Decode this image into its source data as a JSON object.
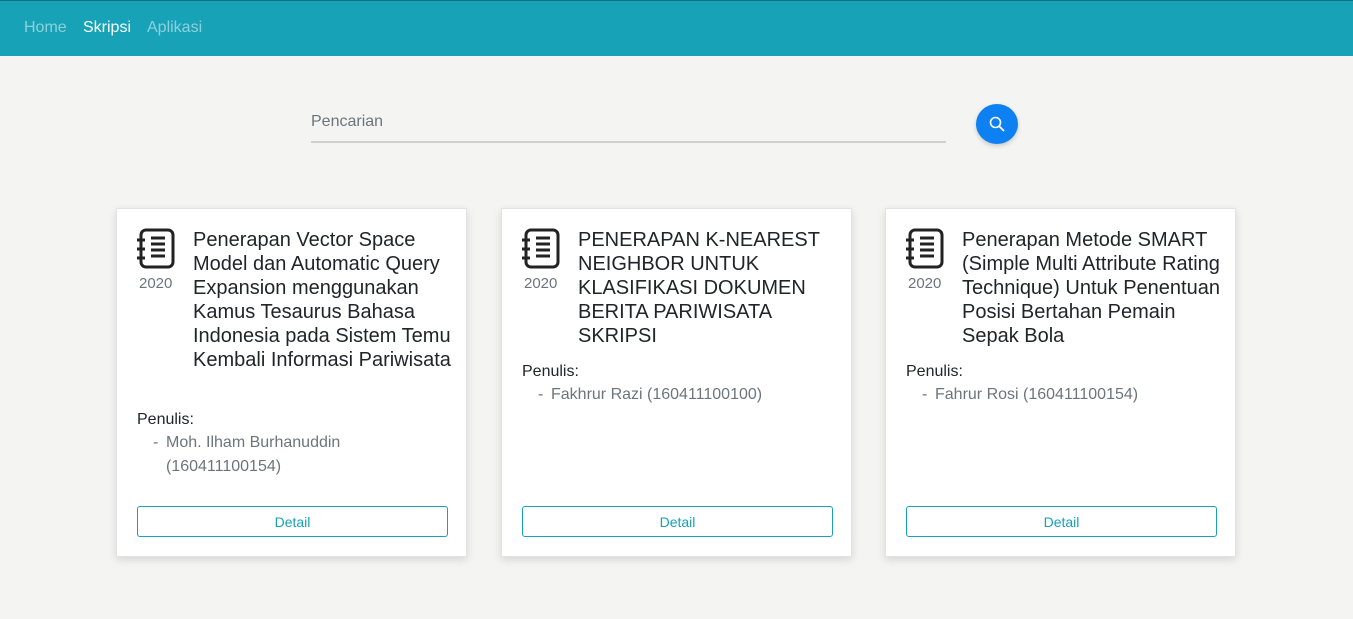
{
  "navbar": {
    "links": [
      {
        "label": "Home",
        "active": false
      },
      {
        "label": "Skripsi",
        "active": true
      },
      {
        "label": "Aplikasi",
        "active": false
      }
    ],
    "color": "#17a2b8"
  },
  "search": {
    "placeholder": "Pencarian",
    "value": "",
    "button_icon": "search-icon",
    "button_color": "#0d80f2"
  },
  "cards": [
    {
      "icon": "notebook-icon",
      "year": "2020",
      "title": "Penerapan Vector Space Model dan Automatic Query Expansion menggunakan Kamus Tesaurus Bahasa Indonesia pada Sistem Temu Kembali Informasi Pariwisata",
      "authors_label": "Penulis:",
      "authors": [
        "Moh. Ilham Burhanuddin (160411100154)"
      ],
      "detail_label": "Detail"
    },
    {
      "icon": "notebook-icon",
      "year": "2020",
      "title": "PENERAPAN K-NEAREST NEIGHBOR UNTUK KLASIFIKASI DOKUMEN BERITA PARIWISATA SKRIPSI",
      "authors_label": "Penulis:",
      "authors": [
        "Fakhrur Razi (160411100100)"
      ],
      "detail_label": "Detail"
    },
    {
      "icon": "notebook-icon",
      "year": "2020",
      "title": "Penerapan Metode SMART (Simple Multi Attribute Rating Technique) Untuk Penentuan Posisi Bertahan Pemain Sepak Bola",
      "authors_label": "Penulis:",
      "authors": [
        "Fahrur Rosi (160411100154)"
      ],
      "detail_label": "Detail"
    }
  ]
}
